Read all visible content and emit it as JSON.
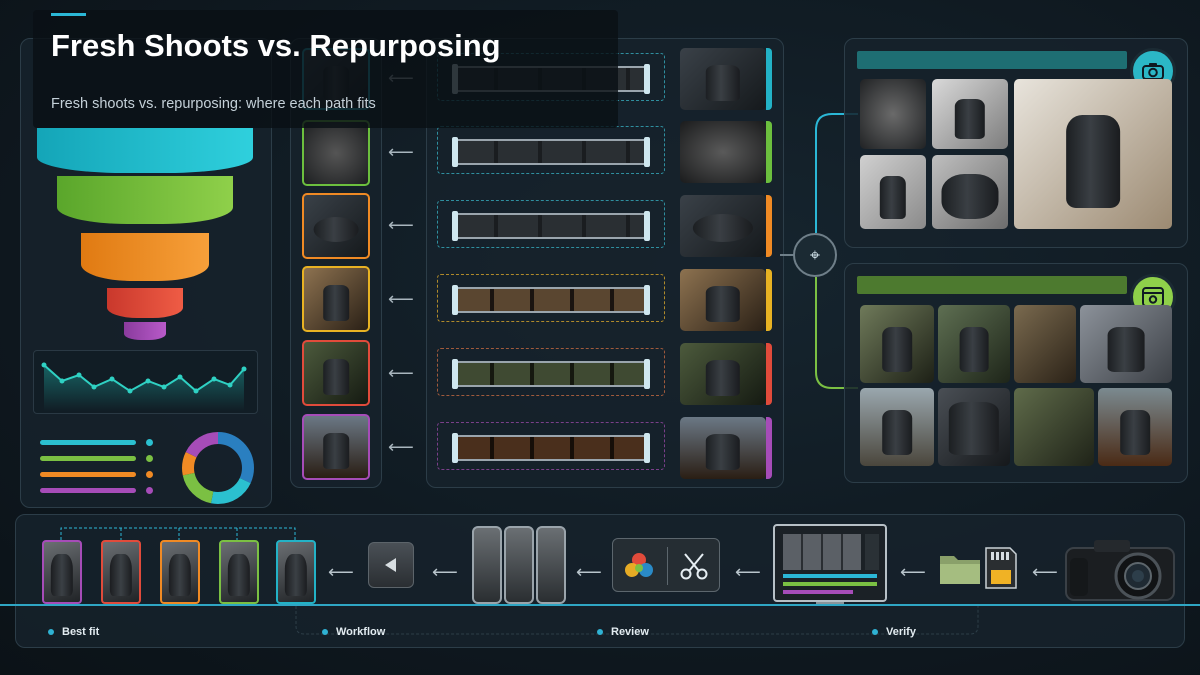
{
  "header": {
    "title": "Fresh Shoots vs. Repurposing",
    "subtitle": "Fresh shoots vs. repurposing: where each path fits"
  },
  "colors": {
    "accent": "#2bb7d6",
    "teal": "#1fa8b7",
    "green": "#7bc043",
    "orange": "#f08a24",
    "yellow": "#e8b223",
    "red": "#e14b3b",
    "purple": "#a64cb8",
    "fresh_shoot_header": "#1e6e73",
    "repurpose_header": "#4d7a2f"
  },
  "icons": {
    "fresh_badge": "camera-icon",
    "repurpose_badge": "image-gallery-icon",
    "hub": "scan-focus-icon",
    "edit": "scissors-icon",
    "color": "color-wheel-icon",
    "folder": "folder-icon",
    "sd_card": "sd-card-icon",
    "play": "play-back-icon"
  },
  "legend": {
    "items": [
      "Best fit",
      "Workflow",
      "Review",
      "Verify"
    ]
  }
}
